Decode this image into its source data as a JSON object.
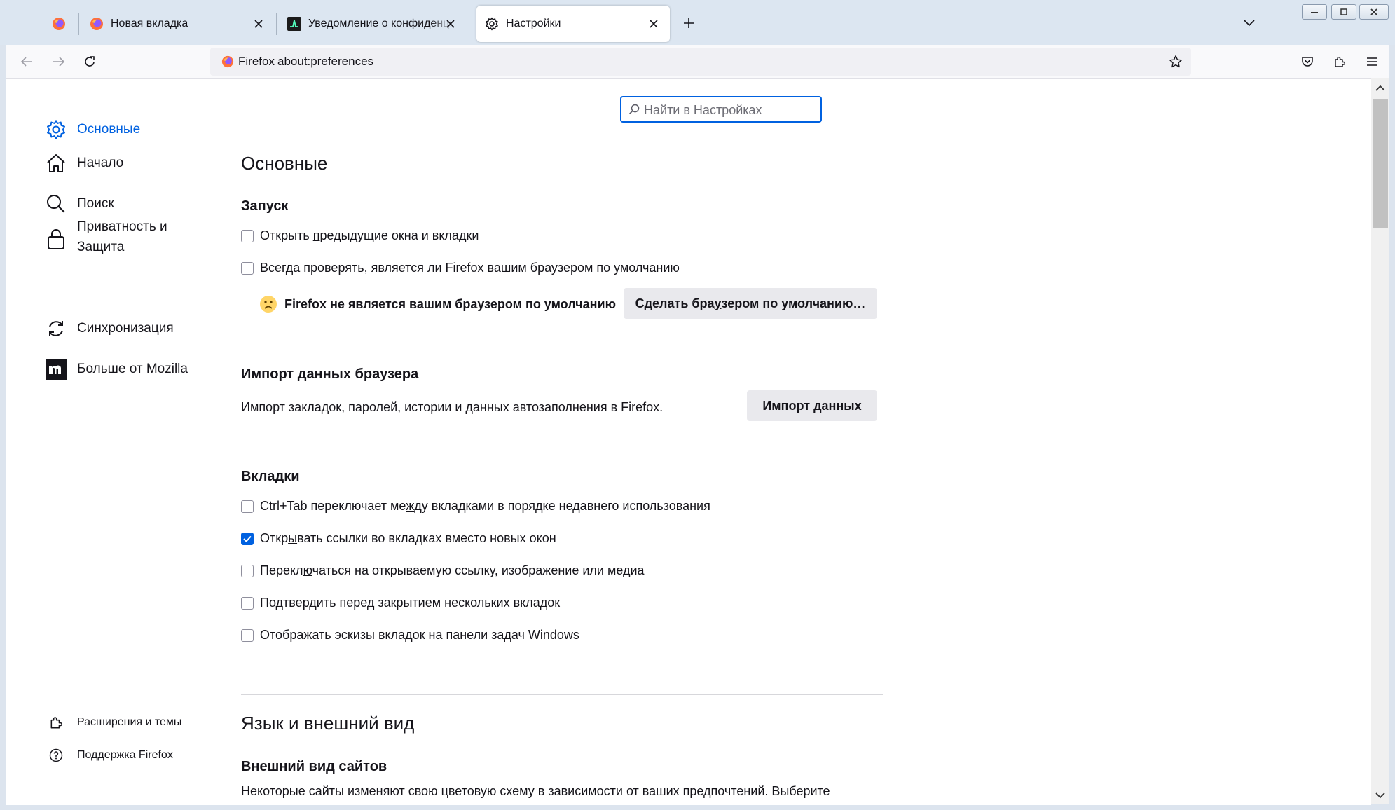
{
  "tabs": {
    "pinned": {
      "icon": "firefox-icon"
    },
    "items": [
      {
        "label": "Новая вкладка",
        "icon": "firefox-icon"
      },
      {
        "label": "Уведомление о конфиденциальности",
        "icon": "pulse-icon"
      },
      {
        "label": "Настройки",
        "icon": "gear-icon",
        "active": true
      }
    ]
  },
  "navbar": {
    "identity_label": "Firefox",
    "url": "about:preferences"
  },
  "search": {
    "placeholder": "Найти в Настройках"
  },
  "sidebar": {
    "categories": [
      {
        "label": "Основные",
        "icon": "gear-icon",
        "selected": true
      },
      {
        "label": "Начало",
        "icon": "home-icon"
      },
      {
        "label": "Поиск",
        "icon": "search-icon"
      },
      {
        "label": "Приватность и Защита",
        "icon": "lock-icon"
      },
      {
        "label": "Синхронизация",
        "icon": "sync-icon"
      },
      {
        "label": "Больше от Mozilla",
        "icon": "mozilla-icon"
      }
    ],
    "footer": [
      {
        "label": "Расширения и темы",
        "icon": "puzzle-icon"
      },
      {
        "label": "Поддержка Firefox",
        "icon": "help-icon"
      }
    ]
  },
  "general": {
    "title": "Основные",
    "startup": {
      "heading": "Запуск",
      "restore_session": {
        "pre": "Открыть ",
        "key": "п",
        "post": "редыдущие окна и вкладки",
        "checked": false
      },
      "check_default": {
        "pre": "Всегда прове",
        "key": "р",
        "post": "ять, является ли Firefox вашим браузером по умолчанию",
        "checked": false
      },
      "not_default_text": "Firefox не является вашим браузером по умолчанию",
      "make_default_button": {
        "pre": "Сделать бра",
        "key": "у",
        "post": "зером по умолчанию…"
      }
    },
    "import": {
      "heading": "Импорт данных браузера",
      "description": "Импорт закладок, паролей, истории и данных автозаполнения в Firefox.",
      "button": {
        "pre": "И",
        "key": "м",
        "post": "порт данных"
      }
    },
    "tabs_section": {
      "heading": "Вкладки",
      "options": [
        {
          "pre": "Ctrl+Tab переключает ме",
          "key": "ж",
          "post": "ду вкладками в порядке недавнего использования",
          "checked": false
        },
        {
          "pre": "Откр",
          "key": "ы",
          "post": "вать ссылки во вкладках вместо новых окон",
          "checked": true
        },
        {
          "pre": "Перекл",
          "key": "ю",
          "post": "чаться на открываемую ссылку, изображение или медиа",
          "checked": false
        },
        {
          "pre": "Подтв",
          "key": "е",
          "post": "рдить перед закрытием нескольких вкладок",
          "checked": false
        },
        {
          "pre": "Отоб",
          "key": "р",
          "post": "ажать эскизы вкладок на панели задач Windows",
          "checked": false
        }
      ]
    }
  },
  "appearance": {
    "title": "Язык и внешний вид",
    "sites_heading": "Внешний вид сайтов",
    "sites_description": "Некоторые сайты изменяют свою цветовую схему в зависимости от ваших предпочтений. Выберите"
  },
  "colors": {
    "accent": "#0061e0",
    "text": "#15141a",
    "button_bg": "#e9e9ed"
  }
}
